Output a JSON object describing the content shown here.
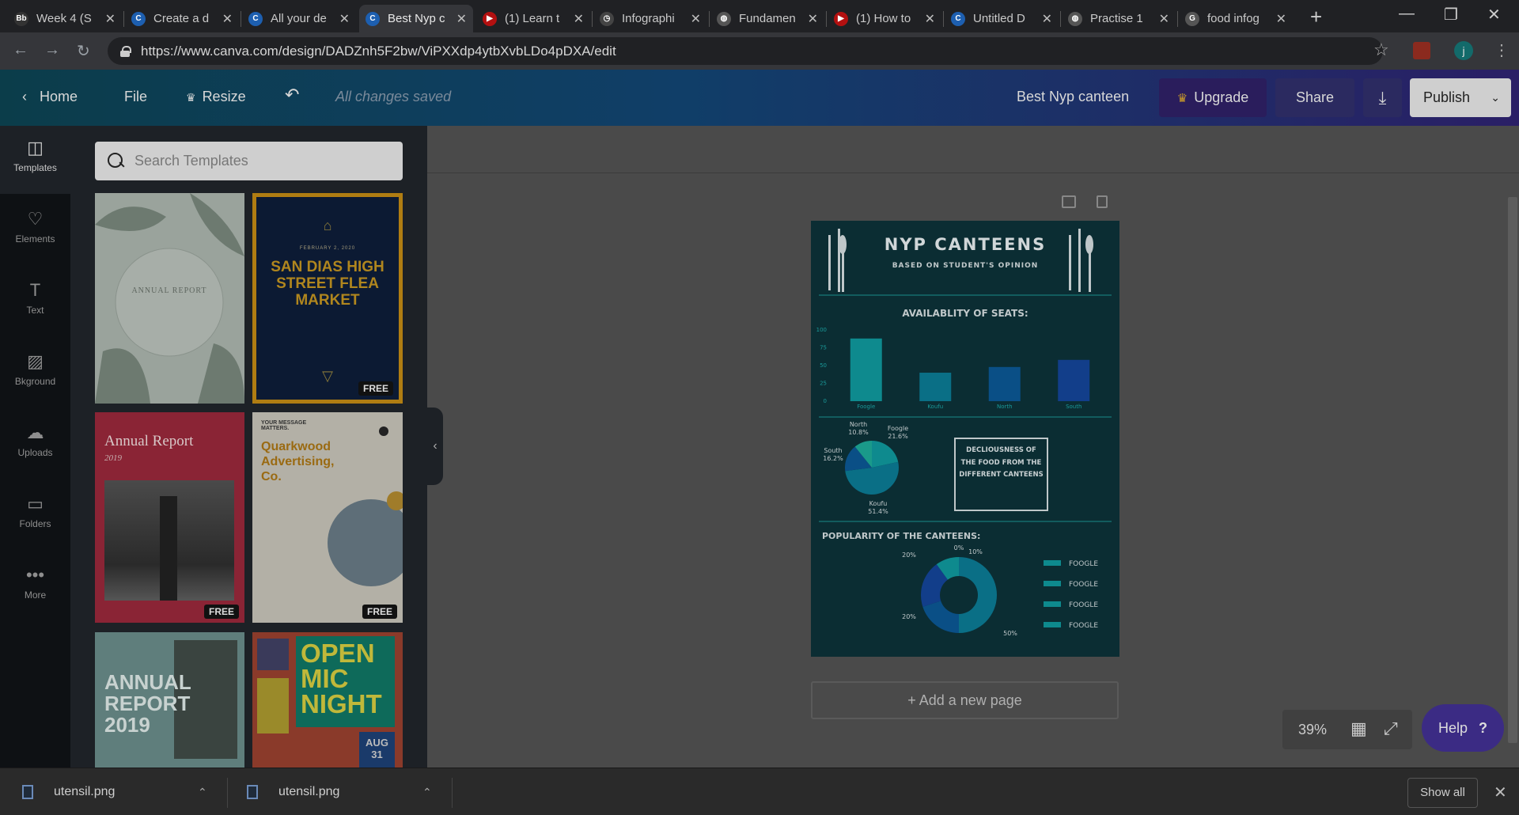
{
  "browser": {
    "tabs": [
      {
        "title": "Week 4 (S",
        "fav": "Bb",
        "fav_color": "#333333"
      },
      {
        "title": "Create a d",
        "fav": "C",
        "fav_color": "#1d5fb0"
      },
      {
        "title": "All your de",
        "fav": "C",
        "fav_color": "#1d5fb0"
      },
      {
        "title": "Best Nyp c",
        "fav": "C",
        "fav_color": "#1d5fb0",
        "active": true
      },
      {
        "title": "(1) Learn t",
        "fav": "▶",
        "fav_color": "#b31010"
      },
      {
        "title": "Infographi",
        "fav": "◷",
        "fav_color": "#444444"
      },
      {
        "title": "Fundamen",
        "fav": "◍",
        "fav_color": "#555555"
      },
      {
        "title": "(1) How to",
        "fav": "▶",
        "fav_color": "#b31010"
      },
      {
        "title": "Untitled D",
        "fav": "C",
        "fav_color": "#1d5fb0"
      },
      {
        "title": "Practise 1",
        "fav": "◍",
        "fav_color": "#555555"
      },
      {
        "title": "food infog",
        "fav": "G",
        "fav_color": "#555555"
      }
    ],
    "url": "https://www.canva.com/design/DADZnh5F2bw/ViPXXdp4ytbXvbLDo4pDXA/edit"
  },
  "header": {
    "home_label": "Home",
    "file_label": "File",
    "resize_label": "Resize",
    "saved_status": "All changes saved",
    "design_title": "Best Nyp canteen",
    "upgrade_label": "Upgrade",
    "share_label": "Share",
    "publish_label": "Publish"
  },
  "rail": {
    "items": [
      {
        "label": "Templates",
        "icon": "templates-icon"
      },
      {
        "label": "Elements",
        "icon": "elements-icon"
      },
      {
        "label": "Text",
        "icon": "text-icon"
      },
      {
        "label": "Bkground",
        "icon": "background-icon"
      },
      {
        "label": "Uploads",
        "icon": "uploads-icon"
      },
      {
        "label": "Folders",
        "icon": "folders-icon"
      },
      {
        "label": "More",
        "icon": "more-icon"
      }
    ]
  },
  "panel": {
    "search_placeholder": "Search Templates",
    "free_badge": "FREE",
    "templates": {
      "botanical_title": "ANNUAL REPORT",
      "flea_date": "FEBRUARY 2, 2020",
      "flea_title": "SAN DIAS HIGH STREET FLEA MARKET",
      "annual_title": "Annual Report",
      "annual_year": "2019",
      "quark_tag": "YOUR MESSAGE MATTERS.",
      "quark_title": "Quarkwood Advertising, Co.",
      "ar2019_title": "ANNUAL REPORT 2019",
      "openmic_title": "OPEN MIC NIGHT",
      "openmic_date": "AUG 31"
    }
  },
  "design": {
    "title": "NYP CANTEENS",
    "subtitle": "BASED ON STUDENT'S OPINION",
    "seats_title": "AVAILABLITY OF SEATS:",
    "deliciousness_text": "DECLIOUSNESS OF THE FOOD FROM THE DIFFERENT CANTEENS",
    "popularity_title": "POPULARITY OF THE CANTEENS:",
    "legend_items": [
      "FOOGLE",
      "FOOGLE",
      "FOOGLE",
      "FOOGLE"
    ]
  },
  "chart_data": [
    {
      "type": "bar",
      "title": "AVAILABLITY OF SEATS:",
      "categories": [
        "Foogle",
        "Koufu",
        "North",
        "South"
      ],
      "values": [
        88,
        40,
        48,
        58
      ],
      "ylim": [
        0,
        100
      ],
      "yticks": [
        "100",
        "75",
        "50",
        "25",
        "0"
      ],
      "colors": [
        "#0e8a8e",
        "#0a6f86",
        "#0a4f86",
        "#123e8a"
      ]
    },
    {
      "type": "pie",
      "categories": [
        "Foogle",
        "Koufu",
        "South",
        "North"
      ],
      "values": [
        21.6,
        51.4,
        16.2,
        10.8
      ],
      "labels": [
        "Foogle 21.6%",
        "Koufu 51.4%",
        "South 16.2%",
        "North 10.8%"
      ],
      "colors": [
        "#0e8a8e",
        "#0a6f86",
        "#0a4f86",
        "#1a9a8a"
      ]
    },
    {
      "type": "pie",
      "title": "POPULARITY OF THE CANTEENS:",
      "categories": [
        "",
        "",
        "",
        ""
      ],
      "values": [
        50,
        20,
        20,
        10
      ],
      "labels": [
        "50%",
        "20%",
        "20%",
        "10%",
        "0%"
      ],
      "colors": [
        "#0a6f86",
        "#0a4f86",
        "#123e8a",
        "#0e8a8e"
      ]
    }
  ],
  "canvas": {
    "add_page_label": "+ Add a new page",
    "zoom": "39%",
    "help_label": "Help",
    "help_mark": "?"
  },
  "downloads": {
    "items": [
      "utensil.png",
      "utensil.png"
    ],
    "show_all_label": "Show all"
  }
}
